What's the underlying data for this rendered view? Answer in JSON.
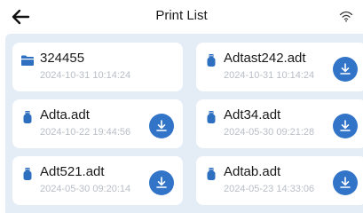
{
  "header": {
    "title": "Print List",
    "back_icon": "arrow-left-icon",
    "status_icon": "wifi-icon"
  },
  "colors": {
    "accent": "#3275c8",
    "list_background": "#e4ecf5",
    "date_text": "#b9bec6"
  },
  "files": [
    {
      "name": "324455",
      "date": "2024-10-31 10:14:24",
      "type": "folder",
      "icon": "folder-icon",
      "downloadable": false
    },
    {
      "name": "Adtast242.adt",
      "date": "2024-10-31 10:14:24",
      "type": "file",
      "icon": "usb-icon",
      "downloadable": true
    },
    {
      "name": "Adta.adt",
      "date": "2024-10-22 19:44:56",
      "type": "file",
      "icon": "usb-icon",
      "downloadable": true
    },
    {
      "name": "Adt34.adt",
      "date": "2024-05-30 09:21:28",
      "type": "file",
      "icon": "usb-icon",
      "downloadable": true
    },
    {
      "name": "Adt521.adt",
      "date": "2024-05-30 09:20:14",
      "type": "file",
      "icon": "usb-icon",
      "downloadable": true
    },
    {
      "name": "Adtab.adt",
      "date": "2024-05-23 14:33:06",
      "type": "file",
      "icon": "usb-icon",
      "downloadable": true
    }
  ]
}
